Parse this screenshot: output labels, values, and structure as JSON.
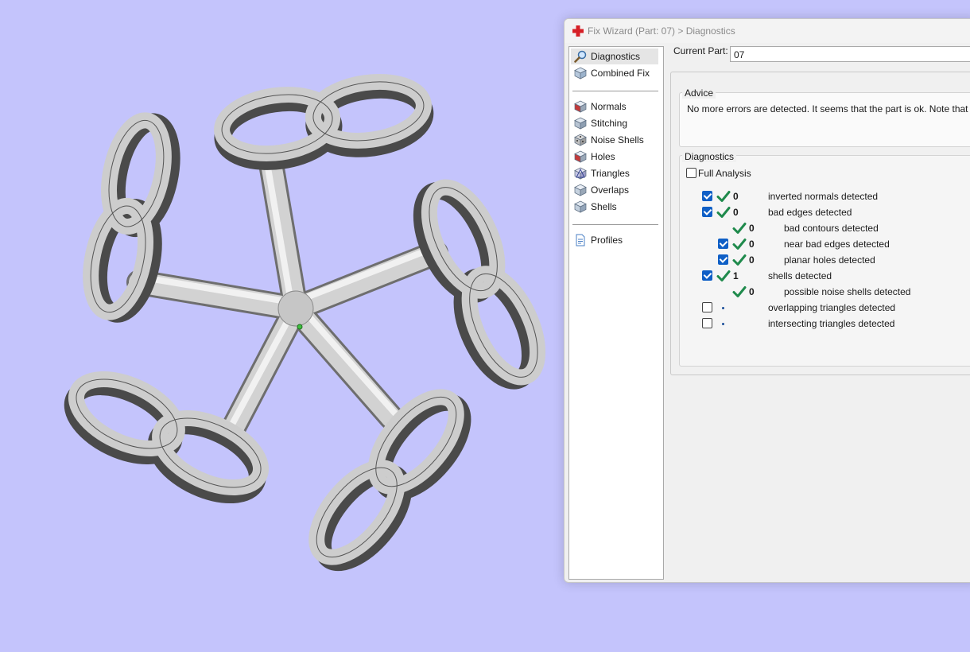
{
  "window": {
    "title": "Fix Wizard (Part: 07) > Diagnostics"
  },
  "nav": {
    "top_items": [
      {
        "label": "Diagnostics",
        "icon": "magnifier-icon",
        "selected": true
      },
      {
        "label": "Combined Fix",
        "icon": "combined-fix-icon",
        "selected": false
      }
    ],
    "fix_items": [
      {
        "label": "Normals",
        "icon": "normals-icon"
      },
      {
        "label": "Stitching",
        "icon": "stitching-icon"
      },
      {
        "label": "Noise Shells",
        "icon": "noise-shells-icon"
      },
      {
        "label": "Holes",
        "icon": "holes-icon"
      },
      {
        "label": "Triangles",
        "icon": "triangles-icon"
      },
      {
        "label": "Overlaps",
        "icon": "overlaps-icon"
      },
      {
        "label": "Shells",
        "icon": "shells-icon"
      }
    ],
    "bottom_items": [
      {
        "label": "Profiles",
        "icon": "profiles-icon"
      }
    ]
  },
  "current_part": {
    "label": "Current Part:",
    "value": "07"
  },
  "advice": {
    "title": "Advice",
    "text": "No more errors are detected. It seems that the part is ok. Note that not a"
  },
  "diagnostics": {
    "title": "Diagnostics",
    "full_analysis": {
      "label": "Full Analysis",
      "checked": false
    },
    "rows": [
      {
        "checkbox": true,
        "checked": true,
        "status": "ok",
        "count": "0",
        "label": "inverted normals detected",
        "level": 0
      },
      {
        "checkbox": true,
        "checked": true,
        "status": "ok",
        "count": "0",
        "label": "bad edges detected",
        "level": 0
      },
      {
        "checkbox": false,
        "checked": false,
        "status": "ok",
        "count": "0",
        "label": "bad contours detected",
        "level": 1
      },
      {
        "checkbox": true,
        "checked": true,
        "status": "ok",
        "count": "0",
        "label": "near bad edges detected",
        "level": 1
      },
      {
        "checkbox": true,
        "checked": true,
        "status": "ok",
        "count": "0",
        "label": "planar holes detected",
        "level": 1
      },
      {
        "checkbox": true,
        "checked": true,
        "status": "ok",
        "count": "1",
        "label": "shells detected",
        "level": 0
      },
      {
        "checkbox": false,
        "checked": false,
        "status": "ok",
        "count": "0",
        "label": "possible noise shells detected",
        "level": 1
      },
      {
        "checkbox": true,
        "checked": false,
        "status": "pending",
        "count": "",
        "label": "overlapping triangles detected",
        "level": 0
      },
      {
        "checkbox": true,
        "checked": false,
        "status": "pending",
        "count": "",
        "label": "intersecting triangles detected",
        "level": 0
      }
    ]
  },
  "colors": {
    "viewport_background": "#c4c4fc",
    "check_green": "#1f8a4c",
    "checkbox_blue": "#0f5fc6"
  }
}
